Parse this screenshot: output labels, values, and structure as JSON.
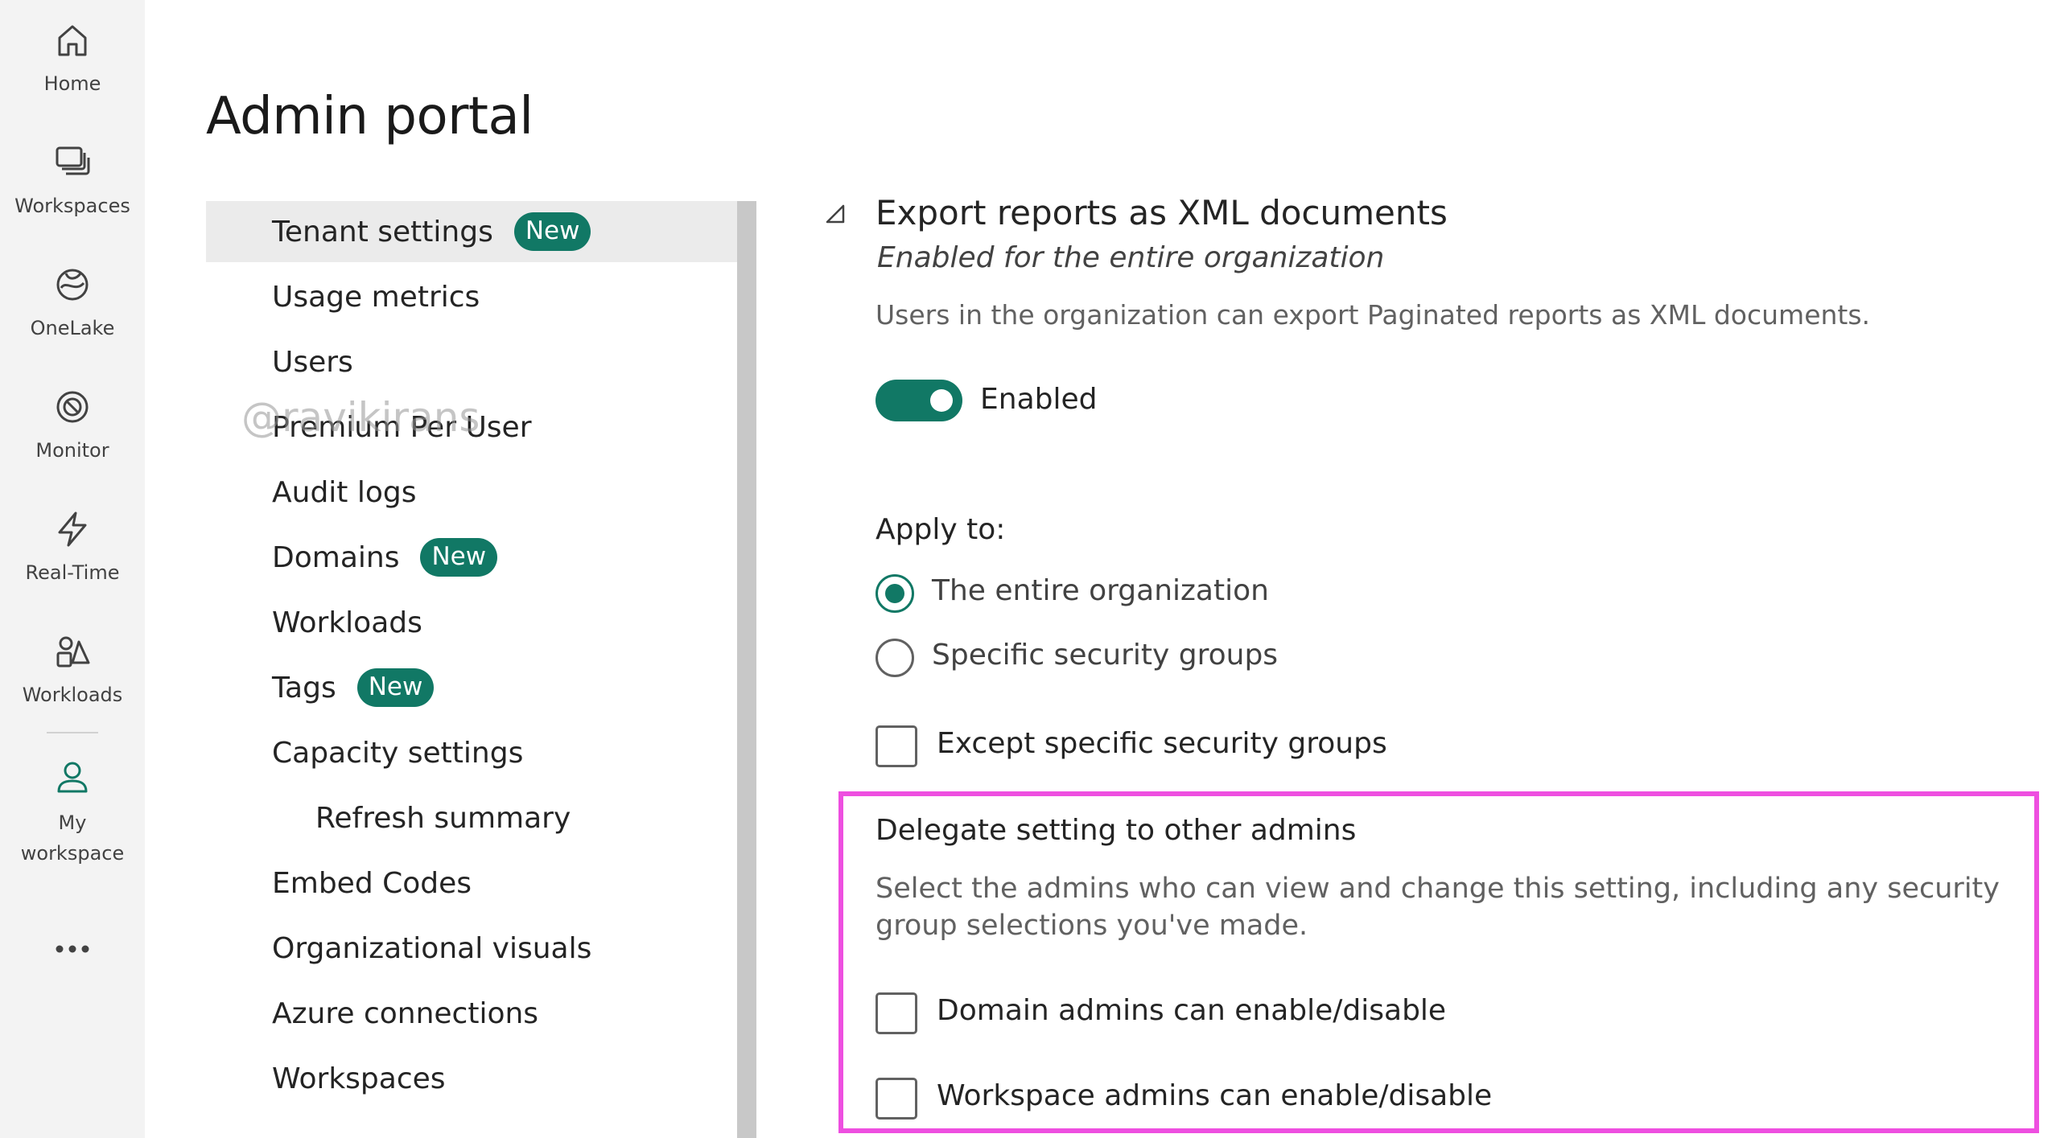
{
  "rail": {
    "items": [
      {
        "label": "Home",
        "icon": "home-icon"
      },
      {
        "label": "Workspaces",
        "icon": "workspaces-icon"
      },
      {
        "label": "OneLake",
        "icon": "onelake-icon"
      },
      {
        "label": "Monitor",
        "icon": "monitor-icon"
      },
      {
        "label": "Real-Time",
        "icon": "real-time-icon"
      },
      {
        "label": "Workloads",
        "icon": "workloads-icon"
      },
      {
        "label": "My workspace",
        "icon": "my-workspace-icon"
      }
    ],
    "more_icon": "more-icon"
  },
  "page": {
    "title": "Admin portal"
  },
  "watermark": "@ravikirans",
  "nav": {
    "items": [
      {
        "label": "Tenant settings",
        "badge": "New",
        "selected": true
      },
      {
        "label": "Usage metrics"
      },
      {
        "label": "Users"
      },
      {
        "label": "Premium Per User"
      },
      {
        "label": "Audit logs"
      },
      {
        "label": "Domains",
        "badge": "New"
      },
      {
        "label": "Workloads"
      },
      {
        "label": "Tags",
        "badge": "New"
      },
      {
        "label": "Capacity settings"
      },
      {
        "label": "Refresh summary",
        "sub": true
      },
      {
        "label": "Embed Codes"
      },
      {
        "label": "Organizational visuals"
      },
      {
        "label": "Azure connections"
      },
      {
        "label": "Workspaces"
      }
    ]
  },
  "setting": {
    "title": "Export reports as XML documents",
    "subtitle": "Enabled for the entire organization",
    "description": "Users in the organization can export Paginated reports as XML documents.",
    "toggle_label": "Enabled",
    "toggle_on": true,
    "apply_to_label": "Apply to:",
    "apply_options": [
      {
        "label": "The entire organization",
        "checked": true
      },
      {
        "label": "Specific security groups",
        "checked": false
      }
    ],
    "except_label": "Except specific security groups",
    "delegate": {
      "title": "Delegate setting to other admins",
      "description": "Select the admins who can view and change this setting, including any security group selections you've made.",
      "options": [
        {
          "label": "Domain admins can enable/disable"
        },
        {
          "label": "Workspace admins can enable/disable"
        }
      ]
    }
  },
  "colors": {
    "accent": "#117865",
    "highlight_box": "#ee4fe0",
    "rail_bg": "#f3f3f3"
  }
}
